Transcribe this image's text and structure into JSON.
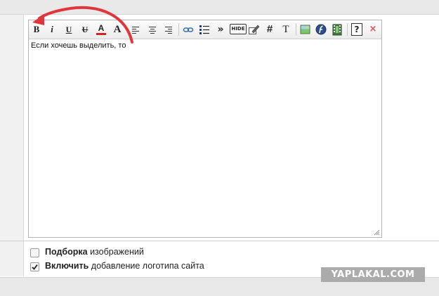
{
  "editor": {
    "text": "Если хочешь выделить, то"
  },
  "toolbar": {
    "bold_label": "B",
    "italic_label": "i",
    "underline_label": "U",
    "strike_label": "U",
    "color_label": "A",
    "size_label": "A",
    "quote_label": "»",
    "hide_label": "HIDE",
    "hash_label": "#",
    "font_label": "T",
    "help_label": "?",
    "close_label": "×"
  },
  "options": [
    {
      "bold": "Подборка",
      "rest": " изображений",
      "checked": false
    },
    {
      "bold": "Включить",
      "rest": " добавление логотипа сайта",
      "checked": true
    }
  ],
  "watermark": {
    "text": "YAPLAKAL.COM"
  },
  "colors": {
    "annotation_arrow": "#e0353b",
    "color_button_underline": "#d22222",
    "close_button": "#d9534f"
  },
  "icons": [
    "bold-icon",
    "italic-icon",
    "underline-icon",
    "strikethrough-icon",
    "text-color-icon",
    "font-size-icon",
    "align-left-icon",
    "align-center-icon",
    "align-right-icon",
    "link-icon",
    "list-icon",
    "quote-icon",
    "hide-icon",
    "edit-icon",
    "hash-icon",
    "font-icon",
    "image-icon",
    "flash-icon",
    "video-icon",
    "help-icon",
    "close-icon"
  ]
}
